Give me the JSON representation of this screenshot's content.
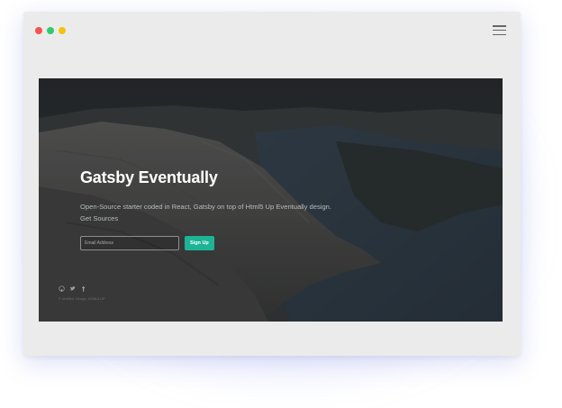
{
  "window": {
    "traffic_lights": [
      {
        "name": "close",
        "color": "#f4534f"
      },
      {
        "name": "minimize",
        "color": "#2ecc71"
      },
      {
        "name": "maximize",
        "color": "#f1c40f"
      }
    ],
    "menu_icon": "hamburger-menu-icon"
  },
  "hero": {
    "title": "Gatsby Eventually",
    "description": "Open-Source starter coded in React, Gatsby on top of Html5 Up Eventually design.",
    "link_label": "Get Sources",
    "email_placeholder": "Email Address",
    "signup_label": "Sign Up",
    "accent_color": "#1cb495"
  },
  "social": {
    "icons": [
      "github-icon",
      "twitter-icon",
      "facebook-icon"
    ]
  },
  "footer": {
    "text": "© Untitled.  Design: HTML5 UP"
  }
}
